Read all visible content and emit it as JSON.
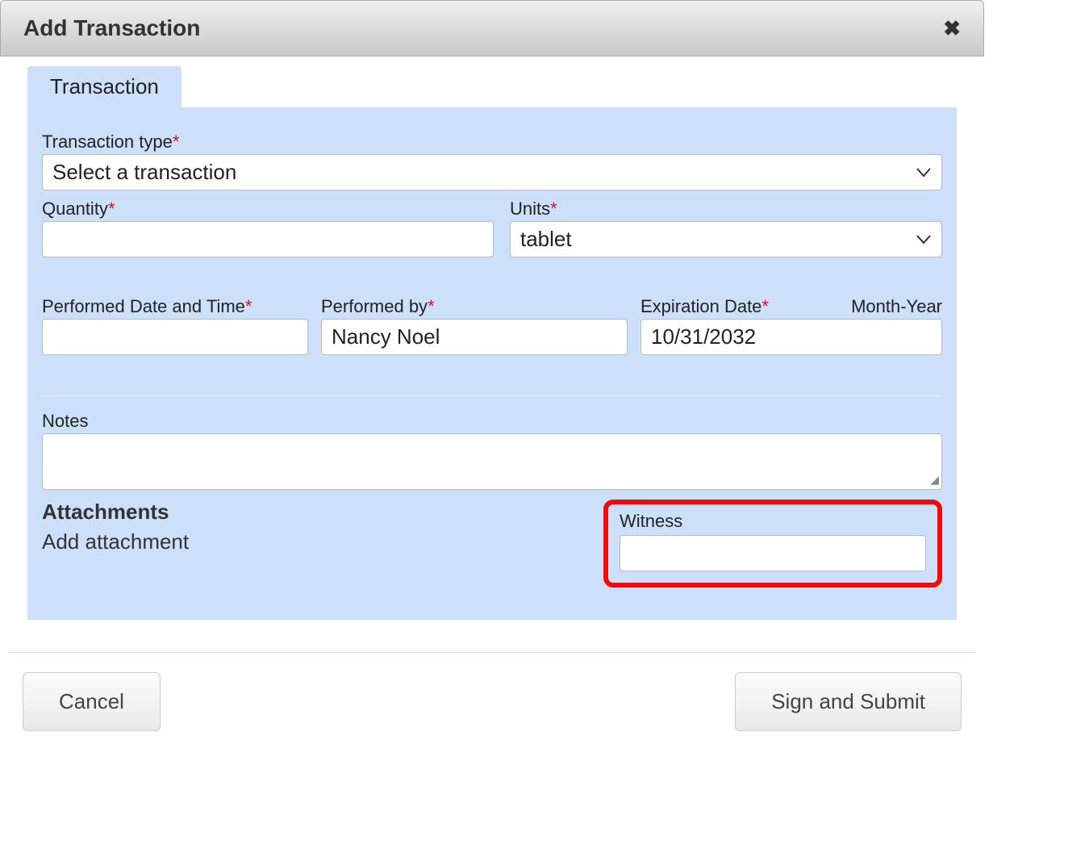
{
  "dialog": {
    "title": "Add Transaction"
  },
  "tabs": {
    "transaction": "Transaction"
  },
  "fields": {
    "transaction_type": {
      "label": "Transaction type",
      "value": "Select a transaction"
    },
    "quantity": {
      "label": "Quantity",
      "value": ""
    },
    "units": {
      "label": "Units",
      "value": "tablet"
    },
    "performed_date": {
      "label": "Performed Date and Time",
      "value": ""
    },
    "performed_by": {
      "label": "Performed by",
      "value": "Nancy Noel"
    },
    "expiration": {
      "label": "Expiration Date",
      "hint": "Month-Year",
      "value": "10/31/2032"
    },
    "notes": {
      "label": "Notes",
      "value": ""
    },
    "witness": {
      "label": "Witness",
      "value": ""
    }
  },
  "attachments": {
    "heading": "Attachments",
    "add_label": "Add attachment"
  },
  "buttons": {
    "cancel": "Cancel",
    "submit": "Sign and Submit"
  }
}
